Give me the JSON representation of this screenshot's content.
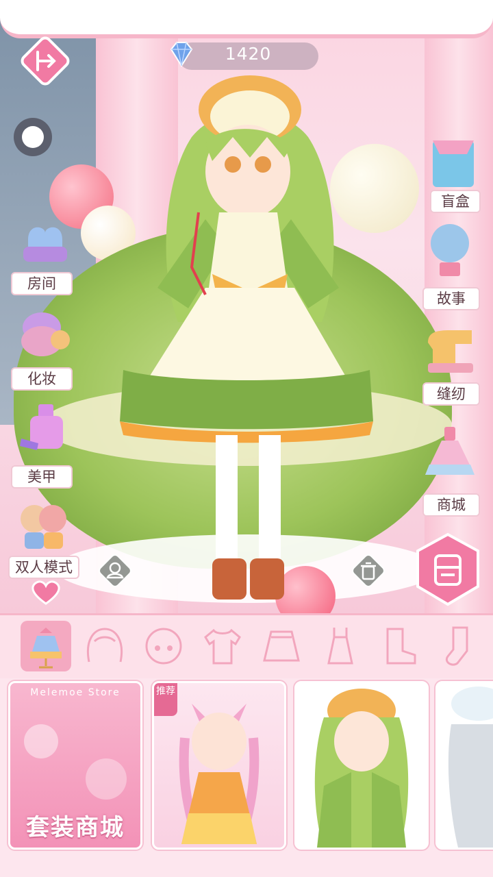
{
  "hud": {
    "coins": "1420",
    "exit_icon": "exit-arrow-icon",
    "gem_icon": "diamond-icon"
  },
  "left_menu": [
    {
      "id": "room",
      "label": "房间",
      "icon": "sofa-icon"
    },
    {
      "id": "makeup",
      "label": "化妆",
      "icon": "compact-icon"
    },
    {
      "id": "nails",
      "label": "美甲",
      "icon": "nail-polish-icon"
    },
    {
      "id": "duo",
      "label": "双人模式",
      "icon": "two-girls-icon"
    }
  ],
  "right_menu": [
    {
      "id": "blindbox",
      "label": "盲盒",
      "icon": "blind-box-icon"
    },
    {
      "id": "story",
      "label": "故事",
      "icon": "hot-air-balloon-icon"
    },
    {
      "id": "sewing",
      "label": "缝纫",
      "icon": "sewing-machine-icon"
    },
    {
      "id": "shop",
      "label": "商城",
      "icon": "dress-icon"
    }
  ],
  "actions": {
    "save_icon": "save-icon",
    "reset_icon": "person-outline-icon",
    "trash_icon": "trash-icon"
  },
  "category_tabs": [
    {
      "id": "full-outfit",
      "icon": "outfit-stand-icon",
      "selected": true
    },
    {
      "id": "hair",
      "icon": "hair-icon",
      "selected": false
    },
    {
      "id": "face",
      "icon": "face-icon",
      "selected": false
    },
    {
      "id": "top",
      "icon": "shirt-icon",
      "selected": false
    },
    {
      "id": "skirt",
      "icon": "skirt-icon",
      "selected": false
    },
    {
      "id": "dress",
      "icon": "dress-icon",
      "selected": false
    },
    {
      "id": "boots",
      "icon": "boot-icon",
      "selected": false
    },
    {
      "id": "socks",
      "icon": "sock-icon",
      "selected": false
    }
  ],
  "cards": {
    "store": {
      "title": "套装商城",
      "subtitle": "Melemoe Store"
    },
    "recommended_badge": "推荐",
    "items": [
      "pink-fox-girl-outfit",
      "green-matcha-outfit",
      "white-angel-outfit"
    ]
  },
  "colors": {
    "accent_pink": "#f17aa3",
    "tab_selected": "#f4a9c1",
    "dress_green": "#7fae47",
    "label_text": "#5a3b44"
  }
}
